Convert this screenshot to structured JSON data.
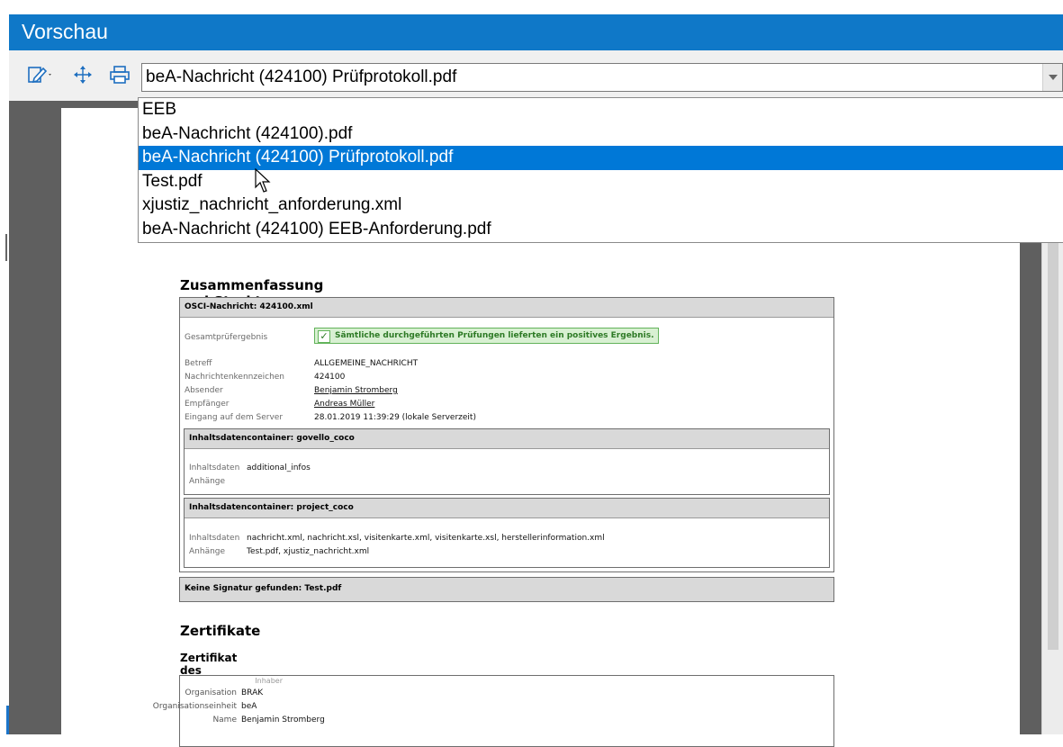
{
  "window": {
    "title": "Vorschau"
  },
  "toolbar": {
    "icons": [
      "edit-icon",
      "move-icon",
      "print-icon"
    ],
    "selected_file": "beA-Nachricht (424100) Prüfprotokoll.pdf"
  },
  "dropdown": {
    "items": [
      "EEB",
      "beA-Nachricht (424100).pdf",
      "beA-Nachricht (424100) Prüfprotokoll.pdf",
      "Test.pdf",
      "xjustiz_nachricht_anforderung.xml",
      "beA-Nachricht (424100) EEB-Anforderung.pdf"
    ],
    "selected_index": 2
  },
  "document": {
    "section1_title": "Zusammenfassung und Struktur",
    "osci_header": "OSCI-Nachricht: 424100.xml",
    "gesamt_label": "Gesamtprüfergebnis",
    "gesamt_value": "Sämtliche durchgeführten Prüfungen lieferten ein positives Ergebnis.",
    "betreff_label": "Betreff",
    "betreff_value": "ALLGEMEINE_NACHRICHT",
    "kennzeichen_label": "Nachrichtenkennzeichen",
    "kennzeichen_value": "424100",
    "absender_label": "Absender",
    "absender_value": "Benjamin Stromberg",
    "empfaenger_label": "Empfänger",
    "empfaenger_value": "Andreas Müller",
    "eingang_label": "Eingang auf dem Server",
    "eingang_value": "28.01.2019 11:39:29 (lokale Serverzeit)",
    "container1_header": "Inhaltsdatencontainer: govello_coco",
    "c1_daten_label": "Inhaltsdaten",
    "c1_daten_value": "additional_infos",
    "c1_anhaenge_label": "Anhänge",
    "container2_header": "Inhaltsdatencontainer: project_coco",
    "c2_daten_label": "Inhaltsdaten",
    "c2_daten_value": "nachricht.xml, nachricht.xsl, visitenkarte.xml, visitenkarte.xsl, herstellerinformation.xml",
    "c2_anhaenge_label": "Anhänge",
    "c2_anhaenge_value": "Test.pdf, xjustiz_nachricht.xml",
    "signatur_header": "Keine Signatur gefunden: Test.pdf",
    "section2_title": "Zertifikate",
    "section2_subtitle": "Zertifikat des Absenders Benjamin Stromberg",
    "cert_inhaber": "Inhaber",
    "cert_org_label": "Organisation",
    "cert_org_value": "BRAK",
    "cert_unit_label": "Organisationseinheit",
    "cert_unit_value": "beA",
    "cert_name_label": "Name",
    "cert_name_value": "Benjamin Stromberg"
  }
}
